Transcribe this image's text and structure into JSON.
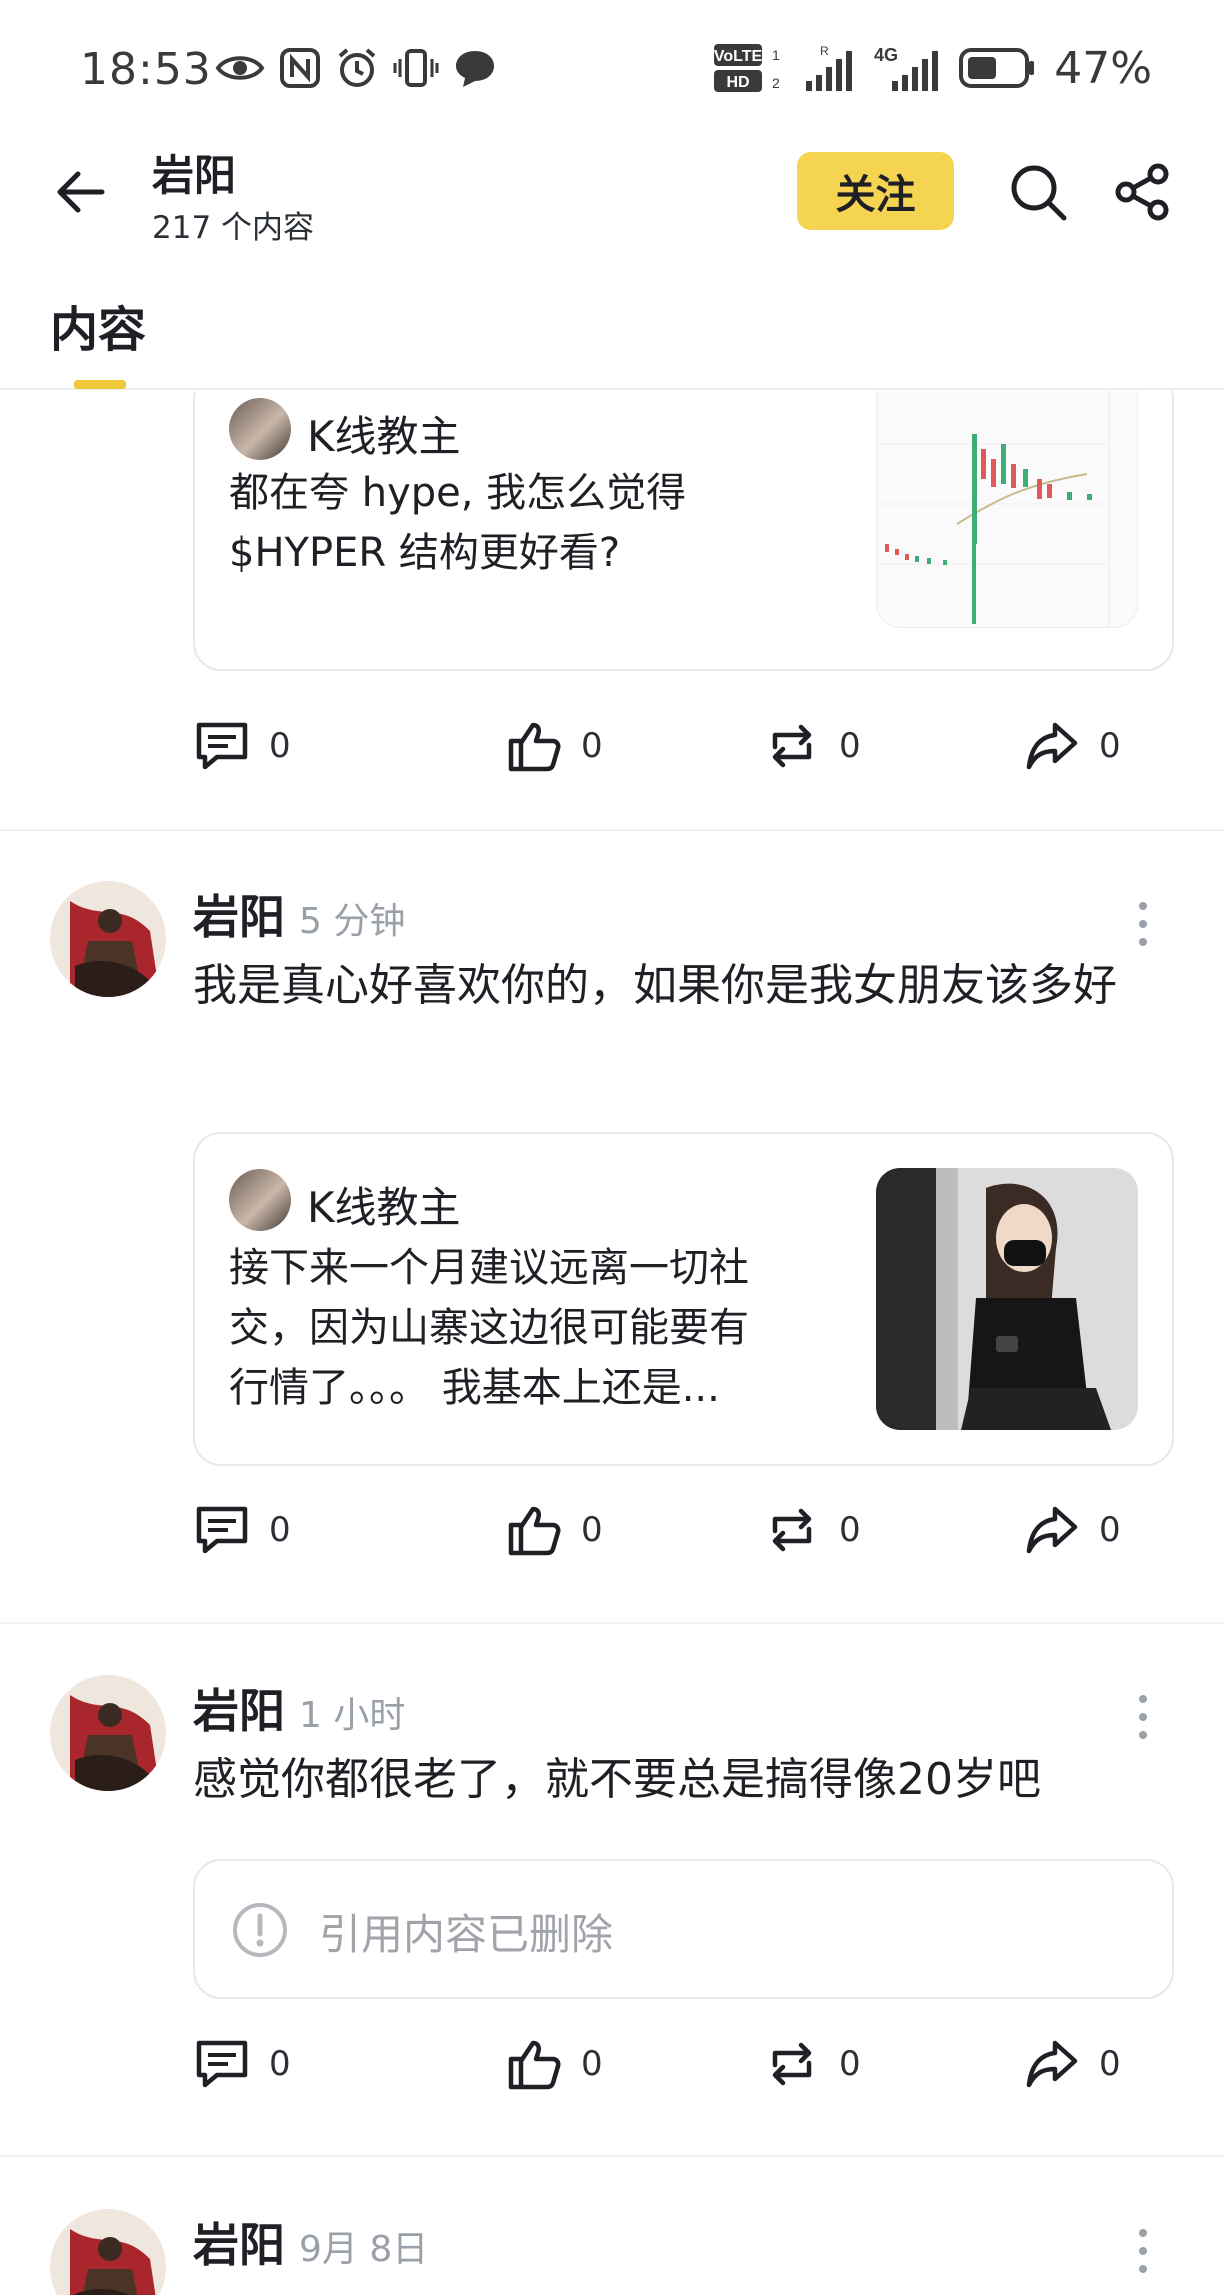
{
  "status_bar": {
    "time": "18:53",
    "battery": "47%",
    "icons": [
      "eye-icon",
      "nfc-icon",
      "alarm-icon",
      "vibrate-icon",
      "message-icon",
      "volte-icon",
      "signal-icon",
      "4g-signal-icon",
      "battery-icon"
    ],
    "volte_label": "VoLTE",
    "hd_label": "HD",
    "net_label": "4G"
  },
  "header": {
    "name": "岩阳",
    "content_count": "217 个内容",
    "follow_label": "关注"
  },
  "tabs": [
    {
      "label": "内容",
      "active": true
    }
  ],
  "feed": {
    "items": [
      {
        "quote": {
          "author": "K线教主",
          "text_line1": "都在夸 hype, 我怎么觉得",
          "text_line2": "$HYPER 结构更好看?",
          "thumb": "candlestick chart screenshot"
        },
        "actions": {
          "comments": "0",
          "likes": "0",
          "reposts": "0",
          "shares": "0"
        }
      },
      {
        "author": "岩阳",
        "time": "5 分钟",
        "text": "我是真心好喜欢你的，如果你是我女朋友该多好",
        "quote": {
          "author": "K线教主",
          "text_line1": "接下来一个月建议远离一切社",
          "text_line2": "交，因为山寨这边很可能要有",
          "text_line3": "行情了。。。 我基本上还是..."
        },
        "actions": {
          "comments": "0",
          "likes": "0",
          "reposts": "0",
          "shares": "0"
        }
      },
      {
        "author": "岩阳",
        "time": "1 小时",
        "text": "感觉你都很老了，就不要总是搞得像20岁吧",
        "deleted_quote": "引用内容已删除",
        "actions": {
          "comments": "0",
          "likes": "0",
          "reposts": "0",
          "shares": "0"
        }
      },
      {
        "author": "岩阳",
        "time": "9月 8日"
      }
    ]
  },
  "colors": {
    "accent": "#f5d451",
    "text": "#1e2026",
    "muted": "#9aa0a8",
    "border": "#e6e8ea"
  }
}
